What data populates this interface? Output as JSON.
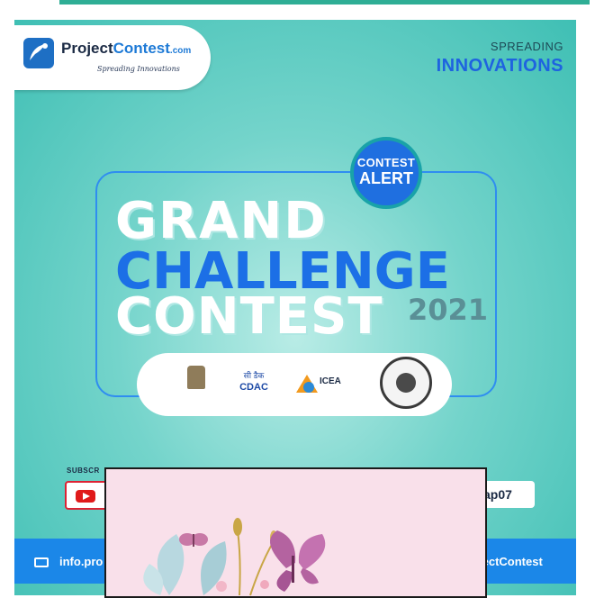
{
  "logo": {
    "name_part1": "Project",
    "name_part2": "Contest",
    "name_tld": ".com",
    "tagline": "Spreading Innovations"
  },
  "header": {
    "spreading": "SPREADING",
    "innovations": "INNOVATIONS"
  },
  "badge": {
    "line1": "CONTEST",
    "line2": "ALERT"
  },
  "title": {
    "line1": "GRAND",
    "line2": "CHALLENGE",
    "line3": "CONTEST",
    "year": "2021"
  },
  "partners": {
    "cdac_line1": "सी डैक",
    "cdac_line2": "CDAC",
    "icea": "ICEA"
  },
  "lower": {
    "subscribe": "SUBSCR",
    "handle": "ap07"
  },
  "footer": {
    "email": "info.pro",
    "social": "jectContest"
  },
  "colors": {
    "teal": "#3fbfb4",
    "blue": "#1c6fe6",
    "footer_blue": "#1b87e8",
    "overlay_pink": "#f9e0ea"
  },
  "icons": [
    "logo-mark",
    "youtube-icon",
    "mail-icon",
    "butterfly-icon",
    "leaf-icon"
  ]
}
